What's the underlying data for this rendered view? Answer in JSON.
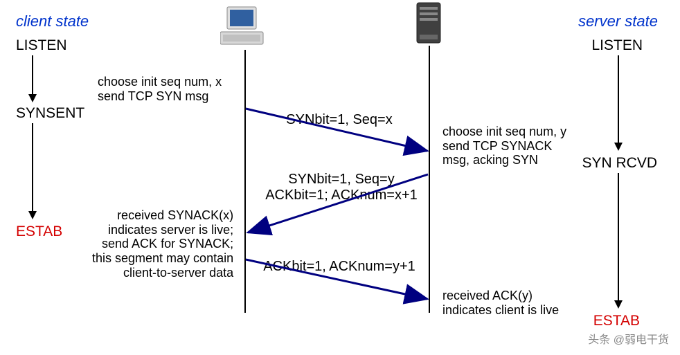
{
  "headers": {
    "client": "client state",
    "server": "server state"
  },
  "client_states": {
    "listen": "LISTEN",
    "synsent": "SYNSENT",
    "estab": "ESTAB"
  },
  "server_states": {
    "listen": "LISTEN",
    "synrcvd": "SYN RCVD",
    "estab": "ESTAB"
  },
  "client_notes": {
    "choose": "choose init seq num, x\nsend TCP SYN msg",
    "received": "received SYNACK(x)\nindicates server is live;\nsend ACK for SYNACK;\nthis segment may contain\nclient-to-server data"
  },
  "server_notes": {
    "choose": "choose init seq num, y\nsend TCP SYNACK\nmsg, acking SYN",
    "received": "received ACK(y)\nindicates client is live"
  },
  "messages": {
    "syn": "SYNbit=1, Seq=x",
    "synack": "SYNbit=1, Seq=y\nACKbit=1; ACKnum=x+1",
    "ack": "ACKbit=1, ACKnum=y+1"
  },
  "watermark": "头条 @弱电干货"
}
